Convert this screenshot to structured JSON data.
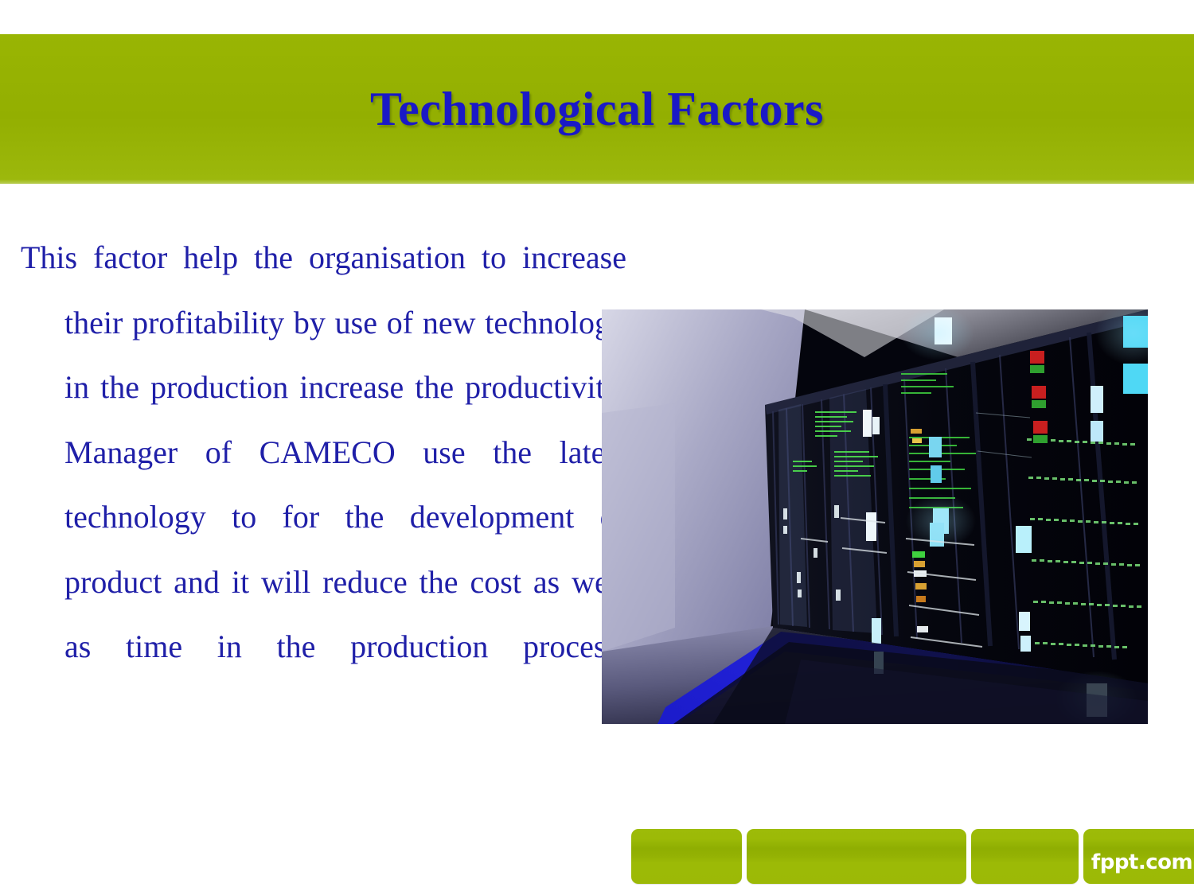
{
  "slide": {
    "title": "Technological Factors",
    "background_color": "#ffffff",
    "band_color": "#96b202",
    "title_color": "#1a19c6",
    "body_color": "#1f1fa8"
  },
  "body": {
    "paragraph": "This factor help the organisation to increase their profitability by use of new technology in the production increase the productivity. Manager of CAMECO use the latest technology to for the development of product and it will reduce the cost as well as time in the production process."
  },
  "photo": {
    "alt": "data-center-server-racks-photo",
    "description": "Dark server room corridor with a long row of illuminated server racks"
  },
  "footer": {
    "bars": [
      "bar-1",
      "bar-2",
      "bar-3"
    ],
    "logo_text": "fppt.com",
    "bar_color": "#96b202"
  }
}
